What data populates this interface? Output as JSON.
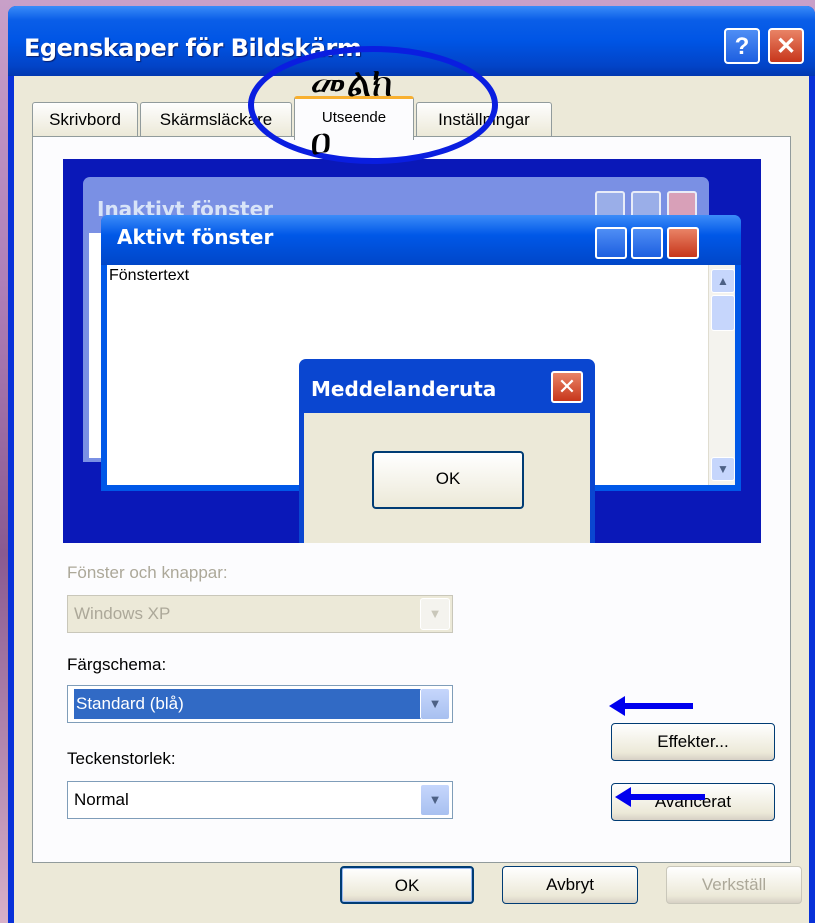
{
  "window": {
    "title": "Egenskaper för Bildskärm",
    "help_label": "?",
    "close_label": "✕"
  },
  "tabs": [
    {
      "label": "Skrivbord"
    },
    {
      "label": "Skärmsläckare"
    },
    {
      "label": "Utseende"
    },
    {
      "label": "Inställningar"
    }
  ],
  "annotation": {
    "glyph_line1": "መልክ",
    "glyph_line2": "ዐ"
  },
  "preview": {
    "inactive_title": "Inaktivt fönster",
    "active_title": "Aktivt fönster",
    "window_text": "Fönstertext",
    "message_title": "Meddelanderuta",
    "message_ok": "OK",
    "close_glyph": "✕"
  },
  "form": {
    "windows_buttons_label": "Fönster och knappar:",
    "windows_buttons_value": "Windows XP",
    "color_scheme_label": "Färgschema:",
    "color_scheme_value": "Standard (blå)",
    "font_size_label": "Teckenstorlek:",
    "font_size_value": "Normal",
    "effects_button": "Effekter...",
    "advanced_button": "Avancerat"
  },
  "footer": {
    "ok": "OK",
    "cancel": "Avbryt",
    "apply": "Verkställ"
  },
  "colors": {
    "title_blue": "#0058e8",
    "annotation_blue": "#0a1ee0",
    "face": "#ece9d8"
  }
}
